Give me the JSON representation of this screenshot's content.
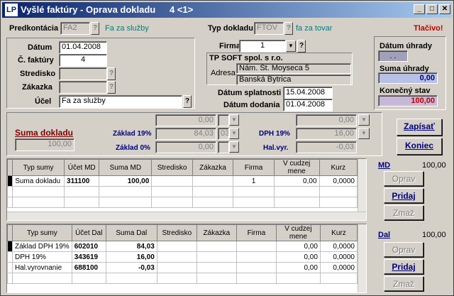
{
  "window": {
    "title": "Vyšlé faktúry - Oprava dokladu",
    "record": "4   <1>",
    "logo": "LP"
  },
  "header": {
    "predkontacia_label": "Predkontácia",
    "predkontacia_value": "FA2",
    "predkontacia_desc": "Fa za služby",
    "typ_label": "Typ dokladu",
    "typ_value": "FTOV",
    "typ_desc": "fa za tovar",
    "print_status": "Tlačivo!"
  },
  "left": {
    "datum_label": "Dátum",
    "datum_value": "01.04.2008",
    "faktura_label": "Č. faktúry",
    "faktura_value": "4",
    "stredisko_label": "Stredisko",
    "zakazka_label": "Zákazka",
    "ucel_label": "Účel",
    "ucel_value": "Fa za služby"
  },
  "firma": {
    "label": "Firma",
    "value": "1",
    "name": "TP SOFT spol. s r.o.",
    "adresa_label": "Adresa:",
    "street": "Nám. Št. Moyseса 5",
    "city": "Banská Bytrica",
    "splatnost_label": "Dátum splatnosti",
    "splatnost_value": "15.04.2008",
    "dodanie_label": "Dátum dodania",
    "dodanie_value": "01.04.2008"
  },
  "right_panel": {
    "uhrady_label": "Dátum úhrady",
    "uhrady_value": ". .",
    "suma_label": "Suma úhrady",
    "suma_value": "0,00",
    "konecny_label": "Konečný stav",
    "konecny_value": "100,00"
  },
  "totals": {
    "suma_label": "Suma dokladu",
    "suma_value": "100,00",
    "zaklad19_label": "Základ 19%",
    "zaklad0_label": "Základ 0%",
    "dph19_label": "DPH 19%",
    "halvyr_label": "Hal.vyr.",
    "f1": "0,00",
    "f2": "84,03",
    "f2b": "03",
    "f3": "0,00",
    "r1": "0,00",
    "r2": "16,00",
    "r3": "-0,03"
  },
  "buttons": {
    "zapisat": "Zapísať",
    "koniec": "Koniec",
    "oprav": "Oprav",
    "pridaj": "Pridaj",
    "zmaz": "Zmaž"
  },
  "md": {
    "label": "MD",
    "total": "100,00"
  },
  "dal": {
    "label": "Dal",
    "total": "100,00"
  },
  "md_table": {
    "headers": [
      "Typ sumy",
      "Účet MD",
      "Suma MD",
      "Stredisko",
      "Zákazka",
      "Firma",
      "V cudzej mene",
      "Kurz"
    ],
    "rows": [
      [
        "Suma dokladu",
        "311100",
        "100,00",
        "",
        "",
        "1",
        "0,00",
        "0,0000"
      ]
    ]
  },
  "dal_table": {
    "headers": [
      "Typ sumy",
      "Účet Dal",
      "Suma Dal",
      "Stredisko",
      "Zákazka",
      "Firma",
      "V cudzej mene",
      "Kurz"
    ],
    "rows": [
      [
        "Základ DPH 19%",
        "602010",
        "84,03",
        "",
        "",
        "",
        "0,00",
        "0,0000"
      ],
      [
        "DPH 19%",
        "343619",
        "16,00",
        "",
        "",
        "",
        "0,00",
        "0,0000"
      ],
      [
        "Hal.vyrovnanie",
        "688100",
        "-0,03",
        "",
        "",
        "",
        "0,00",
        "0,0000"
      ]
    ]
  }
}
